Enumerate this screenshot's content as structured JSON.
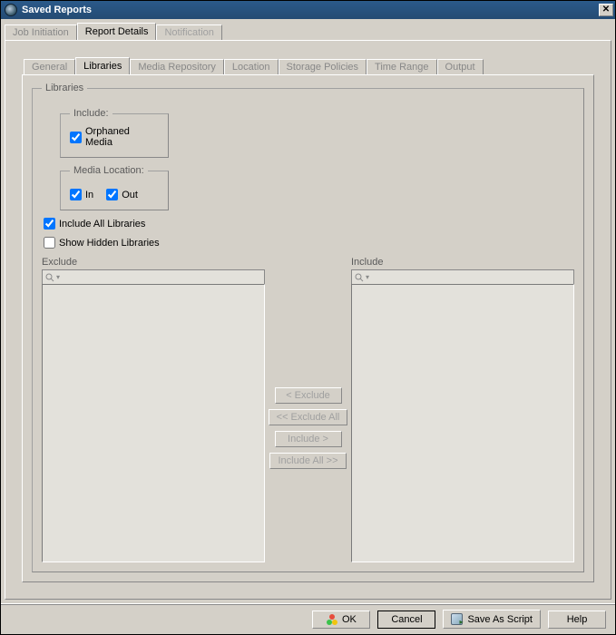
{
  "window": {
    "title": "Saved Reports",
    "close": "✕"
  },
  "outerTabs": {
    "items": [
      {
        "label": "Job Initiation"
      },
      {
        "label": "Report Details"
      },
      {
        "label": "Notification"
      }
    ]
  },
  "innerTabs": {
    "items": [
      {
        "label": "General"
      },
      {
        "label": "Libraries"
      },
      {
        "label": "Media Repository"
      },
      {
        "label": "Location"
      },
      {
        "label": "Storage Policies"
      },
      {
        "label": "Time Range"
      },
      {
        "label": "Output"
      }
    ]
  },
  "libraries": {
    "legend": "Libraries",
    "include": {
      "legend": "Include:",
      "orphaned": {
        "label": "Orphaned Media",
        "checked": true
      }
    },
    "mediaLocation": {
      "legend": "Media Location:",
      "in": {
        "label": "In",
        "checked": true
      },
      "out": {
        "label": "Out",
        "checked": true
      }
    },
    "includeAll": {
      "label": "Include All Libraries",
      "checked": true
    },
    "showHidden": {
      "label": "Show Hidden Libraries",
      "checked": false
    },
    "excludeLabel": "Exclude",
    "includeLabel": "Include"
  },
  "moveButtons": {
    "exclude": "< Exclude",
    "excludeAll": "<< Exclude All",
    "include": "Include >",
    "includeAll": "Include All >>"
  },
  "footer": {
    "ok": "OK",
    "cancel": "Cancel",
    "saveScript": "Save As Script",
    "help": "Help"
  }
}
